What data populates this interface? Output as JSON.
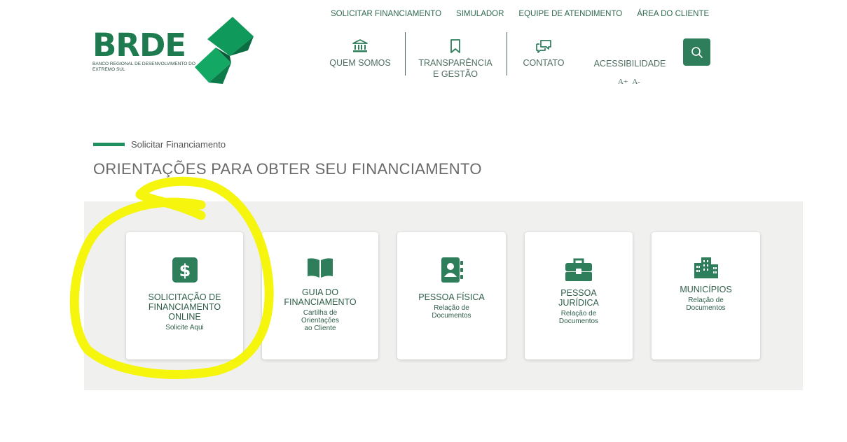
{
  "logo": {
    "wordmark": "BRDE",
    "subtitle": "BANCO REGIONAL DE DESENVOLVIMENTO DO EXTREMO SUL"
  },
  "top_nav": [
    "SOLICITAR FINANCIAMENTO",
    "SIMULADOR",
    "EQUIPE DE ATENDIMENTO",
    "ÁREA DO CLIENTE"
  ],
  "main_nav": {
    "quem_somos": "QUEM SOMOS",
    "transparencia_line1": "TRANSPARÊNCIA",
    "transparencia_line2": "E GESTÃO",
    "contato": "CONTATO",
    "acessibilidade": "ACESSIBILIDADE",
    "font_increase": "A+",
    "font_decrease": "A-"
  },
  "breadcrumb": "Solicitar Financiamento",
  "page_title": "ORIENTAÇÕES PARA OBTER SEU FINANCIAMENTO",
  "cards": [
    {
      "title": [
        "SOLICITAÇÃO DE",
        "FINANCIAMENTO",
        "ONLINE"
      ],
      "sub": [
        "Solicite Aqui"
      ]
    },
    {
      "title": [
        "GUIA DO",
        "FINANCIAMENTO"
      ],
      "sub": [
        "Cartilha de",
        "Orientações",
        "ao Cliente"
      ]
    },
    {
      "title": [
        "PESSOA FÍSICA"
      ],
      "sub": [
        "Relação de",
        "Documentos"
      ]
    },
    {
      "title": [
        "PESSOA",
        "JURÍDICA"
      ],
      "sub": [
        "Relação de",
        "Documentos"
      ]
    },
    {
      "title": [
        "MUNICÍPIOS"
      ],
      "sub": [
        "Relação de",
        "Documentos"
      ]
    }
  ],
  "colors": {
    "brand_green": "#1e7a4f",
    "icon_green": "#2e7d5b",
    "highlight_yellow": "#f4f400"
  }
}
